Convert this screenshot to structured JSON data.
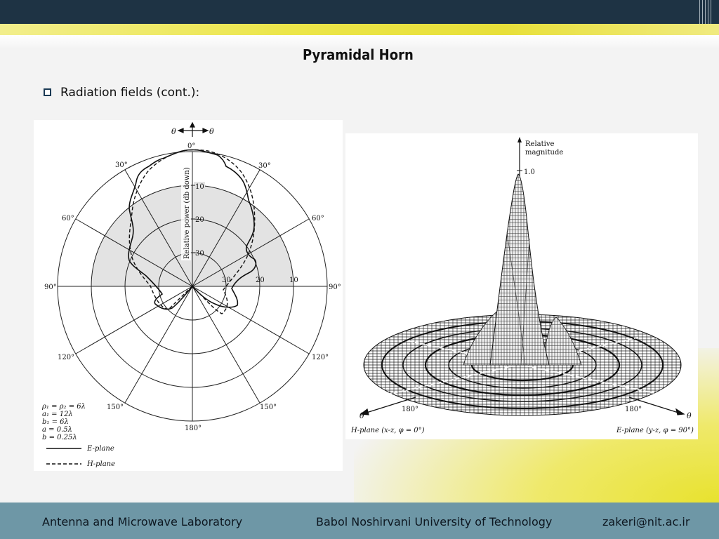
{
  "slide": {
    "title": "Pyramidal Horn",
    "bullet": "Radiation fields (cont.):"
  },
  "polar_figure": {
    "theta_left": "θ",
    "theta_right": "θ",
    "angle_labels": [
      "0°",
      "30°",
      "30°",
      "60°",
      "60°",
      "90°",
      "90°",
      "120°",
      "120°",
      "150°",
      "150°",
      "180°"
    ],
    "radial_labels": [
      "10",
      "20",
      "30"
    ],
    "horizontal_labels": [
      "30",
      "20",
      "10"
    ],
    "axis_label": "Relative power (db down)",
    "params": [
      "ρ₁ = ρ₂ = 6λ",
      "a₁ = 12λ",
      "b₁ = 6λ",
      "a = 0.5λ",
      "b = 0.25λ"
    ],
    "legend": [
      "E-plane",
      "H-plane"
    ]
  },
  "surface_figure": {
    "z_label_line1": "Relative",
    "z_label_line2": "magnitude",
    "peak_label": "1.0",
    "left_angle": "180°",
    "right_angle": "180°",
    "left_theta": "θ",
    "right_theta": "θ",
    "h_plane_caption": "H-plane (x-z, φ = 0°)",
    "e_plane_caption": "E-plane (y-z, φ = 90°)"
  },
  "footer": {
    "lab": "Antenna and Microwave Laboratory",
    "university": "Babol Noshirvani University of Technology",
    "email": "zakeri@nit.ac.ir"
  },
  "colors": {
    "top_bar": "#1e3344",
    "accent_yellow": "#e8e03a",
    "footer": "#6e97a6"
  }
}
